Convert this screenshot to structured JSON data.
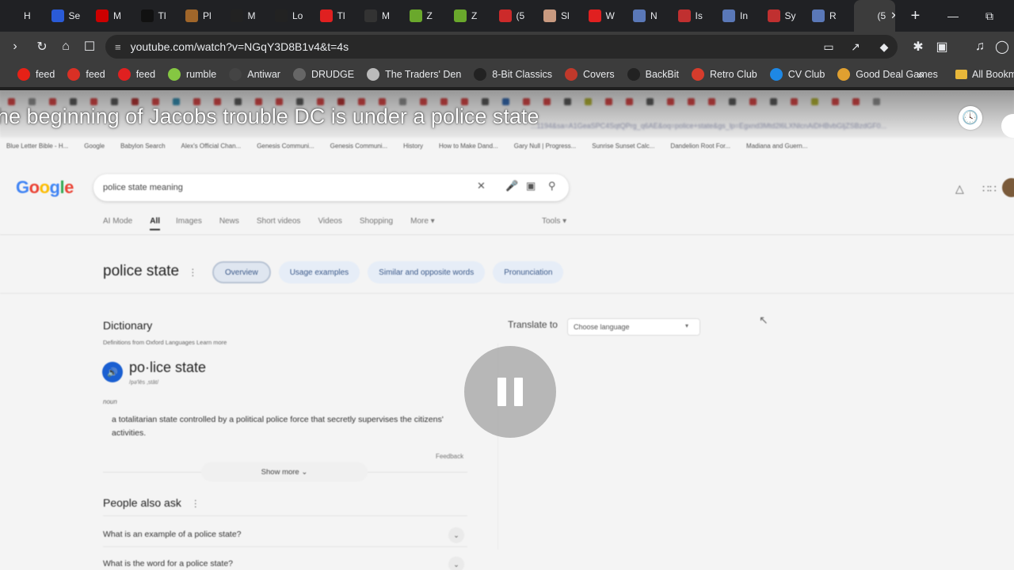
{
  "browser": {
    "tabs": [
      {
        "label": "H",
        "icon": "generic",
        "color": "#202124"
      },
      {
        "label": "Se",
        "icon": "R-logo",
        "color": "#2a5bd7"
      },
      {
        "label": "M",
        "icon": "red-circle",
        "color": "#cc0000"
      },
      {
        "label": "Tl",
        "icon": "tiktok-logo",
        "color": "#111111"
      },
      {
        "label": "Pl",
        "icon": "image-thumb",
        "color": "#a0662a"
      },
      {
        "label": "M",
        "icon": "dark-circle",
        "color": "#222222"
      },
      {
        "label": "Lo",
        "icon": "dark-circle",
        "color": "#222222"
      },
      {
        "label": "Tl",
        "icon": "red-c",
        "color": "#e02020"
      },
      {
        "label": "M",
        "icon": "dark-oval",
        "color": "#333333"
      },
      {
        "label": "Z",
        "icon": "rt-logo",
        "color": "#6aa82c"
      },
      {
        "label": "Z",
        "icon": "rt-logo",
        "color": "#6aa82c"
      },
      {
        "label": "(5",
        "icon": "red-circle",
        "color": "#cc2a2a"
      },
      {
        "label": "Sl",
        "icon": "portrait-thumb",
        "color": "#c99a80"
      },
      {
        "label": "W",
        "icon": "red-c",
        "color": "#e02020"
      },
      {
        "label": "N",
        "icon": "user-icon",
        "color": "#5a78b8"
      },
      {
        "label": "Is",
        "icon": "flag-icon",
        "color": "#c03030"
      },
      {
        "label": "In",
        "icon": "user-icon",
        "color": "#5a78b8"
      },
      {
        "label": "Sy",
        "icon": "flag-icon",
        "color": "#c03030"
      },
      {
        "label": "R",
        "icon": "person-icon",
        "color": "#5a78b8"
      },
      {
        "label": "(5",
        "icon": "generic",
        "color": "#3c3c3c"
      }
    ],
    "new_tab": "+",
    "url": "youtube.com/watch?v=NGqY3D8B1v4&t=4s",
    "bookmarks": [
      {
        "label": "feed",
        "color": "#e62117"
      },
      {
        "label": "feed",
        "color": "#d93025"
      },
      {
        "label": "feed",
        "color": "#e02020"
      },
      {
        "label": "rumble",
        "color": "#85c742"
      },
      {
        "label": "Antiwar",
        "color": "#444444"
      },
      {
        "label": "DRUDGE",
        "color": "#666666"
      },
      {
        "label": "The Traders' Den",
        "color": "#bbbbbb"
      },
      {
        "label": "8-Bit Classics",
        "color": "#222222"
      },
      {
        "label": "Covers",
        "color": "#c0392b"
      },
      {
        "label": "BackBit",
        "color": "#222222"
      },
      {
        "label": "Retro Club",
        "color": "#d63c2c"
      },
      {
        "label": "CV Club",
        "color": "#1e88e5"
      },
      {
        "label": "Good Deal Games",
        "color": "#e0a030"
      }
    ],
    "bookmarks_more": "»",
    "all_bookmarks": "All Bookm"
  },
  "video": {
    "title": "he beginning of Jacobs trouble DC is under a police state",
    "state": "paused"
  },
  "google": {
    "logo": "Google",
    "query": "police state meaning",
    "tabs": [
      "AI Mode",
      "All",
      "Images",
      "News",
      "Short videos",
      "Videos",
      "Shopping",
      "More ▾"
    ],
    "selected_tab": "All",
    "tools": "Tools ▾",
    "term": "police state",
    "chips": [
      "Overview",
      "Usage examples",
      "Similar and opposite words",
      "Pronunciation"
    ],
    "dictionary": {
      "heading": "Dictionary",
      "source": "Definitions from Oxford Languages   Learn more",
      "word": "po·lice state",
      "phonetic": "/pə'lēs ,stāt/",
      "pos": "noun",
      "definition": "a totalitarian state controlled by a political police force that secretly supervises the citizens' activities.",
      "feedback": "Feedback",
      "show_more": "Show more ⌄"
    },
    "translate": {
      "label": "Translate to",
      "placeholder": "Choose language"
    },
    "people_also_ask": {
      "heading": "People also ask",
      "questions": [
        "What is an example of a police state?",
        "What is the word for a police state?"
      ]
    },
    "mini_url": "...1194&sa=A1GeaSPC4SqtQPrg_q6AE&oq=police+state&gs_lp=Egxnd3Mtd2l6LXNlcnAiDHBvbGljZSBzdGF0...",
    "mini_bookmarks": [
      "Blue Letter Bible - H...",
      "Google",
      "Babylon Search",
      "Alex's Official Chan...",
      "Genesis Communi...",
      "Genesis Communi...",
      "History",
      "How to Make Dand...",
      "Gary Null | Progress...",
      "Sunrise Sunset Calc...",
      "Dandelion Root For...",
      "Madiana and Guern..."
    ]
  },
  "colors": {
    "chrome_dark": "#202124",
    "toolbar": "#3c3c3c",
    "google_blue": "#4285f4",
    "google_red": "#ea4335",
    "google_yellow": "#fbbc05",
    "google_green": "#34a853"
  }
}
